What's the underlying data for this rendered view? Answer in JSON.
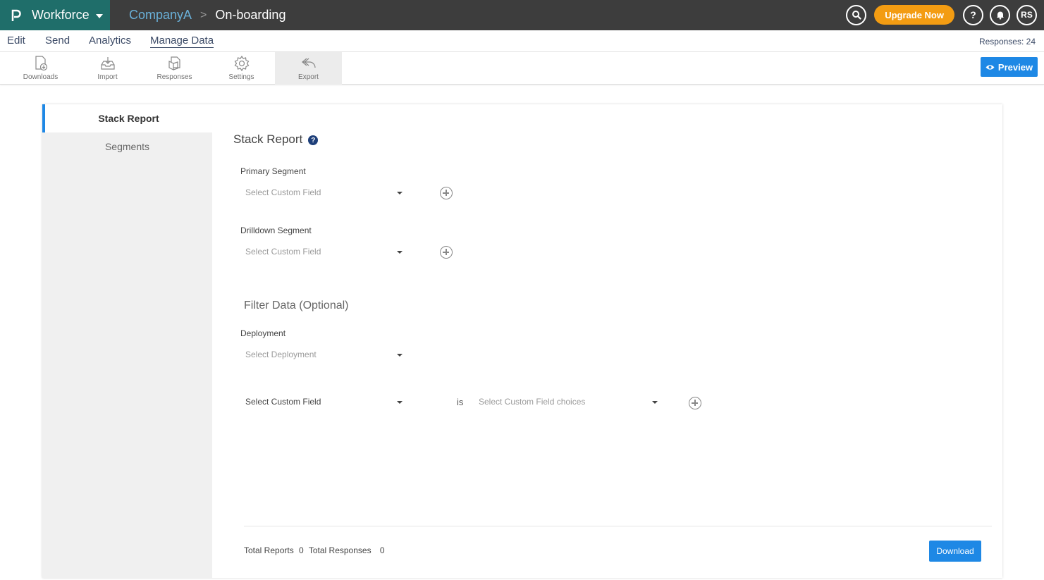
{
  "app": {
    "title": "Workforce",
    "logo_icon": "p-logo-icon"
  },
  "breadcrumb": {
    "company": "CompanyA",
    "separator": ">",
    "page": "On-boarding"
  },
  "header_right": {
    "upgrade_label": "Upgrade Now",
    "help_label": "?",
    "avatar_initials": "RS"
  },
  "menu": {
    "items": [
      "Edit",
      "Send",
      "Analytics",
      "Manage Data"
    ],
    "active": "Manage Data",
    "responses_label": "Responses: 24"
  },
  "toolbar": {
    "items": [
      {
        "label": "Downloads",
        "icon": "downloads-icon"
      },
      {
        "label": "Import",
        "icon": "import-icon"
      },
      {
        "label": "Responses",
        "icon": "responses-icon"
      },
      {
        "label": "Settings",
        "icon": "settings-icon"
      },
      {
        "label": "Export",
        "icon": "export-icon",
        "active": true
      }
    ],
    "preview_label": "Preview"
  },
  "sidebar": {
    "items": [
      "Stack Report",
      "Segments"
    ],
    "active": "Stack Report"
  },
  "main": {
    "title": "Stack Report",
    "primary_segment": {
      "label": "Primary Segment",
      "placeholder": "Select Custom Field"
    },
    "drilldown_segment": {
      "label": "Drilldown Segment",
      "placeholder": "Select Custom Field"
    },
    "filter_title": "Filter Data (Optional)",
    "deployment": {
      "label": "Deployment",
      "placeholder": "Select Deployment"
    },
    "filter_row": {
      "field_value": "Select Custom Field",
      "operator": "is",
      "choices_placeholder": "Select Custom Field choices"
    },
    "totals": {
      "reports_label": "Total Reports",
      "reports_value": "0",
      "responses_label": "Total Responses",
      "responses_value": "0"
    },
    "download_label": "Download"
  },
  "colors": {
    "brand": "#1f6e6a",
    "topbar": "#3d3d3d",
    "accent": "#1e88e5",
    "upgrade": "#f39c12",
    "link": "#6ab0d8"
  }
}
